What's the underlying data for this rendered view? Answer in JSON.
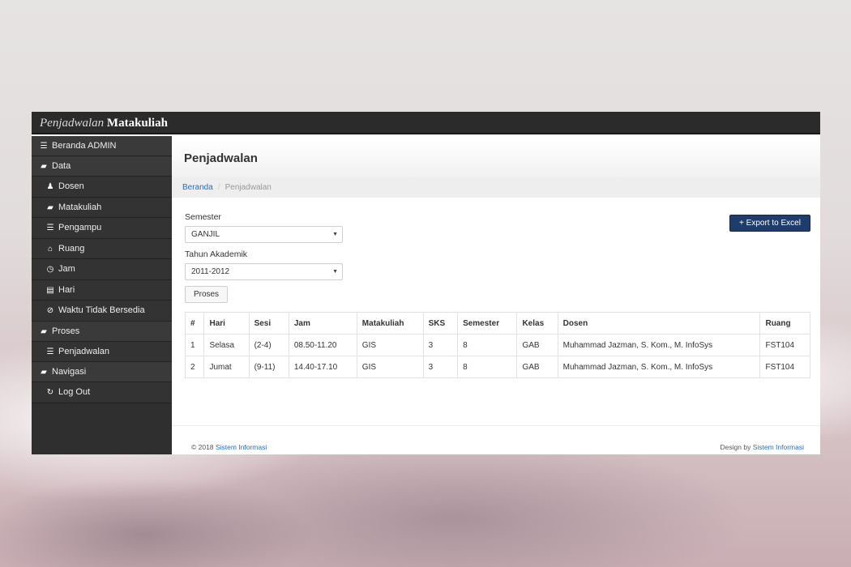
{
  "app": {
    "brand_light": "Penjadwalan",
    "brand_bold": "Matakuliah"
  },
  "sidebar": {
    "items": [
      {
        "label": "Beranda ADMIN",
        "icon": "list-icon",
        "glyph": "☰",
        "type": "top"
      },
      {
        "label": "Data",
        "icon": "book-icon",
        "glyph": "▰",
        "type": "top"
      },
      {
        "label": "Dosen",
        "icon": "user-icon",
        "glyph": "♟",
        "type": "sub"
      },
      {
        "label": "Matakuliah",
        "icon": "book-icon",
        "glyph": "▰",
        "type": "sub"
      },
      {
        "label": "Pengampu",
        "icon": "list-icon",
        "glyph": "☰",
        "type": "sub"
      },
      {
        "label": "Ruang",
        "icon": "home-icon",
        "glyph": "⌂",
        "type": "sub"
      },
      {
        "label": "Jam",
        "icon": "clock-icon",
        "glyph": "◷",
        "type": "sub"
      },
      {
        "label": "Hari",
        "icon": "calendar-icon",
        "glyph": "▤",
        "type": "sub"
      },
      {
        "label": "Waktu Tidak Bersedia",
        "icon": "check-circle-icon",
        "glyph": "⊘",
        "type": "sub"
      },
      {
        "label": "Proses",
        "icon": "book-icon",
        "glyph": "▰",
        "type": "top"
      },
      {
        "label": "Penjadwalan",
        "icon": "list-icon",
        "glyph": "☰",
        "type": "sub"
      },
      {
        "label": "Navigasi",
        "icon": "book-icon",
        "glyph": "▰",
        "type": "top"
      },
      {
        "label": "Log Out",
        "icon": "refresh-icon",
        "glyph": "↻",
        "type": "sub"
      }
    ]
  },
  "page": {
    "title": "Penjadwalan",
    "breadcrumb": {
      "home": "Beranda",
      "separator": "/",
      "current": "Penjadwalan"
    }
  },
  "form": {
    "semester_label": "Semester",
    "semester_value": "GANJIL",
    "tahun_label": "Tahun Akademik",
    "tahun_value": "2011-2012",
    "proses_label": "Proses",
    "export_label": "Export to Excel",
    "export_glyph": "+"
  },
  "table": {
    "headers": [
      "#",
      "Hari",
      "Sesi",
      "Jam",
      "Matakuliah",
      "SKS",
      "Semester",
      "Kelas",
      "Dosen",
      "Ruang"
    ],
    "rows": [
      [
        "1",
        "Selasa",
        "(2-4)",
        "08.50-11.20",
        "GIS",
        "3",
        "8",
        "GAB",
        "Muhammad Jazman, S. Kom., M. InfoSys",
        "FST104"
      ],
      [
        "2",
        "Jumat",
        "(9-11)",
        "14.40-17.10",
        "GIS",
        "3",
        "8",
        "GAB",
        "Muhammad Jazman, S. Kom., M. InfoSys",
        "FST104"
      ]
    ]
  },
  "footer": {
    "copyright": "© 2018",
    "left_link": "Sistem Informasi",
    "design_by": "Design by",
    "right_link": "Sistem Informasi"
  },
  "colors": {
    "topbar": "#2b2b2b",
    "sidebar": "#3a3a3a",
    "export_button": "#1f3d6b",
    "link": "#2a6ebb"
  }
}
